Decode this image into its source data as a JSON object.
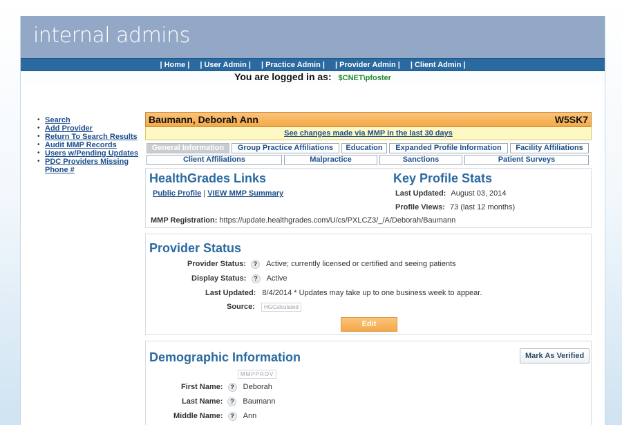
{
  "header": {
    "title": "internal admins"
  },
  "nav": [
    "| Home |",
    "| User Admin |",
    "| Practice Admin |",
    "| Provider Admin |",
    "| Client Admin |"
  ],
  "login": {
    "label": "You are logged in as:",
    "user": "$CNET\\pfoster"
  },
  "sidebar": {
    "items": [
      "Search",
      "Add Provider",
      "Return To Search Results",
      "Audit MMP Records",
      "Users w/Pending Updates",
      "PDC Providers Missing",
      "Phone #"
    ]
  },
  "provider": {
    "name": "Baumann, Deborah Ann",
    "code": "W5SK7"
  },
  "changes_link": "See changes made via MMP in the last 30 days",
  "tabs": {
    "row1": [
      "General Information",
      "Group Practice Affiliations",
      "Education",
      "Expanded Profile Information",
      "Facility Affiliations"
    ],
    "row2": [
      "Client Affiliations",
      "Malpractice",
      "Sanctions",
      "Patient Surveys"
    ]
  },
  "links_box": {
    "title": "HealthGrades Links",
    "public_profile": "Public Profile",
    "sep": "|",
    "mmp_summary": "VIEW MMP Summary",
    "mmp_label": "MMP Registration:",
    "mmp_url": "https://update.healthgrades.com/U/cs/PXLCZ3/_/A/Deborah/Baumann"
  },
  "stats_box": {
    "title": "Key Profile Stats",
    "last_updated_label": "Last Updated:",
    "last_updated": "August 03, 2014",
    "views_label": "Profile Views:",
    "views": "73",
    "views_note": "(last 12 months)"
  },
  "status_box": {
    "title": "Provider Status",
    "provider_status_label": "Provider Status:",
    "provider_status": "Active; currently licensed or certified and seeing patients",
    "display_status_label": "Display Status:",
    "display_status": "Active",
    "last_updated_label": "Last Updated:",
    "last_updated": "8/4/2014 * Updates may take up to one business week to appear.",
    "source_label": "Source:",
    "source": "HGCalculated",
    "edit": "Edit",
    "help": "?"
  },
  "demo_box": {
    "title": "Demographic Information",
    "verify": "Mark As Verified",
    "tag": "MMPPROV",
    "first_label": "First Name:",
    "first": "Deborah",
    "last_label": "Last Name:",
    "last": "Baumann",
    "middle_label": "Middle Name:",
    "middle": "Ann"
  }
}
